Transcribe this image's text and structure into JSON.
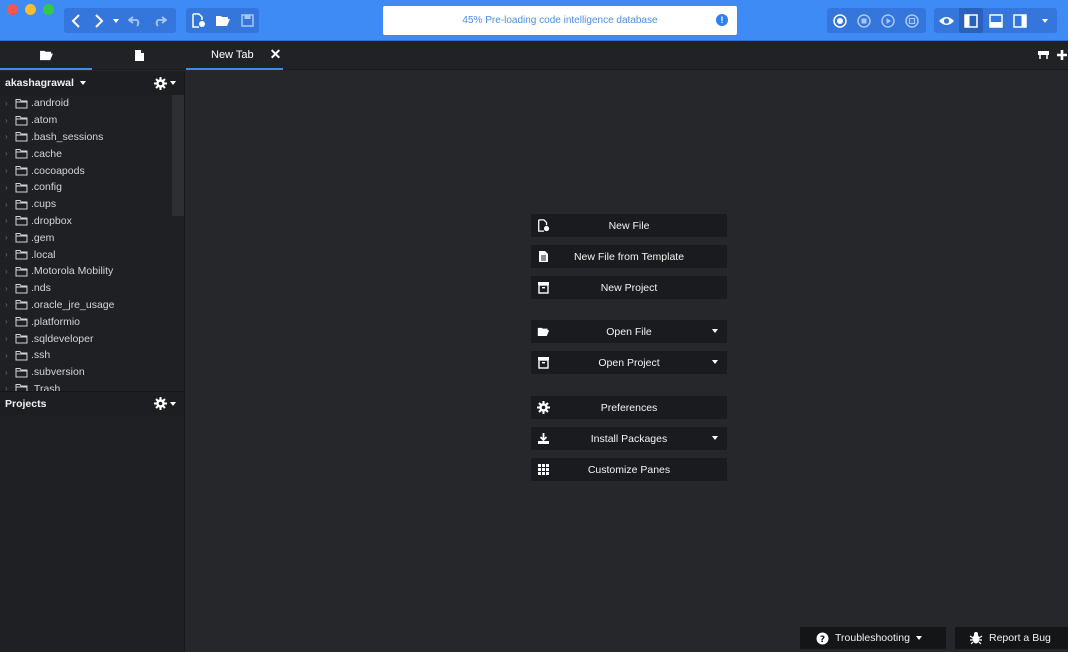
{
  "status_bar": {
    "message": "45% Pre-loading code intelligence database",
    "progress_percent": 45
  },
  "sidebar": {
    "user_label": "akashagrawal",
    "folders": [
      ".android",
      ".atom",
      ".bash_sessions",
      ".cache",
      ".cocoapods",
      ".config",
      ".cups",
      ".dropbox",
      ".gem",
      ".local",
      ".Motorola Mobility",
      ".nds",
      ".oracle_jre_usage",
      ".platformio",
      ".sqldeveloper",
      ".ssh",
      ".subversion",
      ".Trash"
    ],
    "projects_label": "Projects"
  },
  "tabs": {
    "new_tab_label": "New Tab",
    "close_symbol": "✕"
  },
  "quickstart": {
    "new_file": "New File",
    "new_file_template": "New File from Template",
    "new_project": "New Project",
    "open_file": "Open File",
    "open_project": "Open Project",
    "preferences": "Preferences",
    "install_packages": "Install Packages",
    "customize_panes": "Customize Panes"
  },
  "footer": {
    "troubleshooting": "Troubleshooting",
    "report_bug": "Report a Bug"
  },
  "colors": {
    "accent": "#3f8bf6",
    "background": "#26272b",
    "sidebar": "#1f2023",
    "button": "#1a1b1e"
  }
}
